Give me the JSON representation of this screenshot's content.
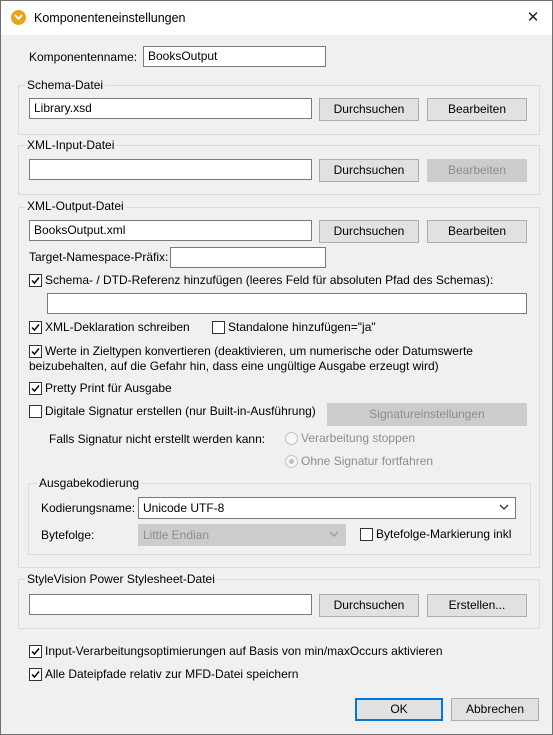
{
  "window": {
    "title": "Komponenteneinstellungen",
    "close_glyph": "✕"
  },
  "component": {
    "name_label": "Komponentenname:",
    "name_value": "BooksOutput"
  },
  "schema": {
    "group_title": "Schema-Datei",
    "file_value": "Library.xsd",
    "browse_label": "Durchsuchen",
    "edit_label": "Bearbeiten"
  },
  "xml_input": {
    "group_title": "XML-Input-Datei",
    "file_value": "",
    "browse_label": "Durchsuchen",
    "edit_label": "Bearbeiten"
  },
  "xml_output": {
    "group_title": "XML-Output-Datei",
    "file_value": "BooksOutput.xml",
    "browse_label": "Durchsuchen",
    "edit_label": "Bearbeiten",
    "ns_prefix_label": "Target-Namespace-Präfix:",
    "ns_prefix_value": "",
    "schema_ref_label": "Schema- / DTD-Referenz hinzufügen (leeres Feld für absoluten Pfad des Schemas):",
    "schema_ref_checked": true,
    "schema_ref_value": "",
    "xml_decl_label": "XML-Deklaration schreiben",
    "xml_decl_checked": true,
    "standalone_label": "Standalone hinzufügen=\"ja\"",
    "standalone_checked": false,
    "convert_line1": "Werte in Zieltypen konvertieren (deaktivieren, um numerische oder Datumswerte",
    "convert_line2": "beizubehalten, auf die Gefahr hin, dass eine ungültige Ausgabe erzeugt wird)",
    "convert_checked": true,
    "pretty_print_label": "Pretty Print für Ausgabe",
    "pretty_print_checked": true,
    "digital_sig_label": "Digitale Signatur erstellen (nur Built-in-Ausführung)",
    "digital_sig_checked": false,
    "sig_settings_label": "Signatureinstellungen",
    "sig_fail_label": "Falls Signatur nicht erstellt werden kann:",
    "radio_stop_label": "Verarbeitung stoppen",
    "radio_continue_label": "Ohne Signatur fortfahren",
    "selected_radio": "Ohne Signatur fortfahren"
  },
  "encoding": {
    "group_title": "Ausgabekodierung",
    "encoding_label": "Kodierungsname:",
    "encoding_value": "Unicode UTF-8",
    "byteorder_label": "Bytefolge:",
    "byteorder_value": "Little Endian",
    "bom_label": "Bytefolge-Markierung inkl",
    "bom_checked": false
  },
  "stylevision": {
    "group_title": "StyleVision Power Stylesheet-Datei",
    "file_value": "",
    "browse_label": "Durchsuchen",
    "create_label": "Erstellen..."
  },
  "options": {
    "optimize_label": "Input-Verarbeitungsoptimierungen auf Basis von min/maxOccurs aktivieren",
    "optimize_checked": true,
    "relative_label": "Alle Dateipfade relativ zur MFD-Datei speichern",
    "relative_checked": true
  },
  "footer": {
    "ok_label": "OK",
    "cancel_label": "Abbrechen"
  },
  "colors": {
    "accent": "#0078d7",
    "dialog_bg": "#f0f0f0",
    "app_icon": "#e8a317"
  }
}
